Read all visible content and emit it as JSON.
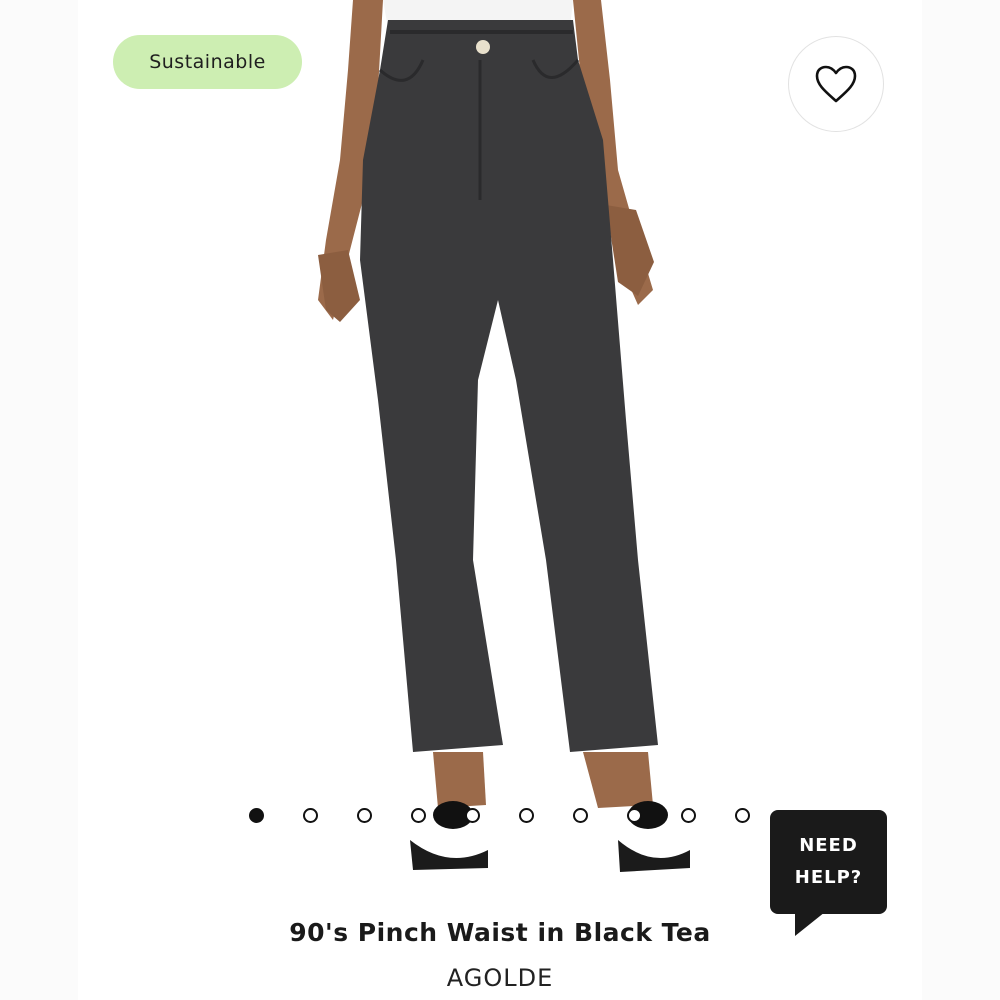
{
  "product": {
    "badge": "Sustainable",
    "title": "90's Pinch Waist in Black Tea",
    "brand": "AGOLDE",
    "image_description_icon": "product-photo"
  },
  "carousel": {
    "count": 10,
    "active_index": 0
  },
  "help": {
    "label": "NEED\nHELP?"
  },
  "icons": {
    "wishlist": "heart-icon"
  },
  "colors": {
    "badge_bg": "#cdeeb2",
    "denim": "#3a3a3c",
    "help_bg": "#1a1a1a"
  }
}
